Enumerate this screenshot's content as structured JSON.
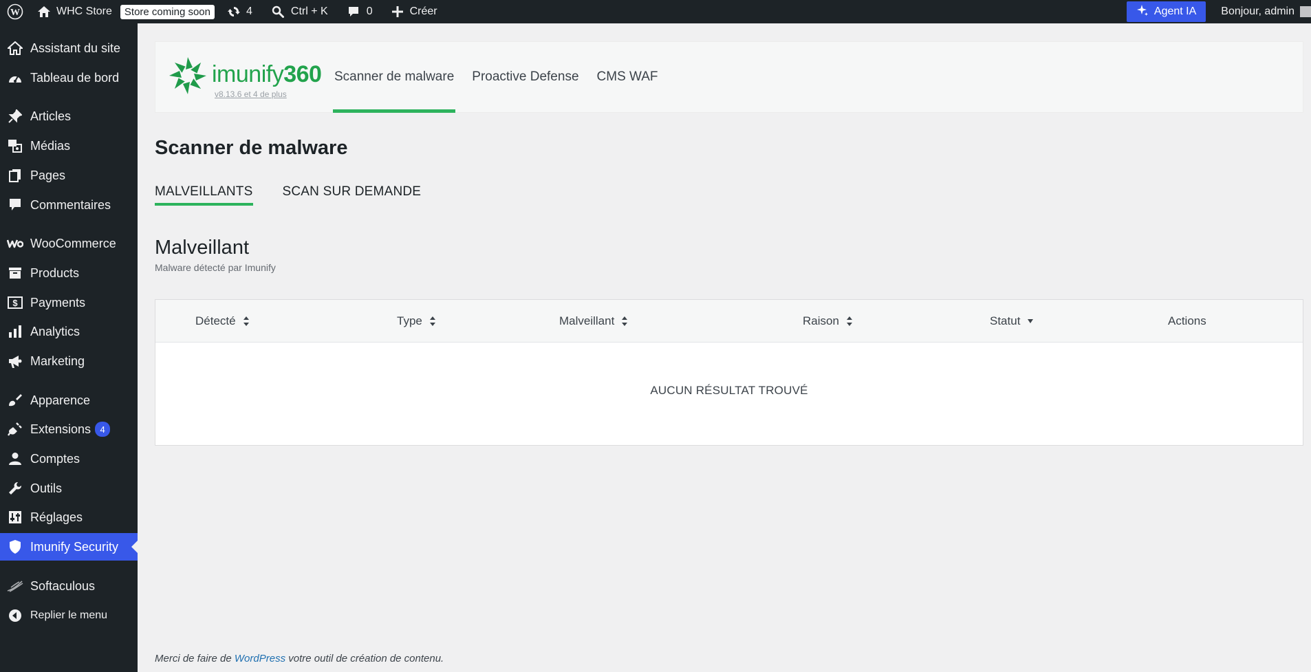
{
  "adminbar": {
    "site_name": "WHC Store",
    "store_badge": "Store coming soon",
    "updates_count": "4",
    "search_shortcut": "Ctrl + K",
    "comments_count": "0",
    "create_label": "Créer",
    "agent_label": "Agent IA",
    "greeting": "Bonjour, admin"
  },
  "sidebar": {
    "items": [
      {
        "label": "Assistant du site",
        "icon": "home-icon"
      },
      {
        "label": "Tableau de bord",
        "icon": "dashboard-icon"
      },
      {
        "label": "Articles",
        "icon": "pin-icon"
      },
      {
        "label": "Médias",
        "icon": "media-icon"
      },
      {
        "label": "Pages",
        "icon": "pages-icon"
      },
      {
        "label": "Commentaires",
        "icon": "comment-icon"
      },
      {
        "label": "WooCommerce",
        "icon": "woo-icon"
      },
      {
        "label": "Products",
        "icon": "archive-icon"
      },
      {
        "label": "Payments",
        "icon": "dollar-icon"
      },
      {
        "label": "Analytics",
        "icon": "bar-chart-icon"
      },
      {
        "label": "Marketing",
        "icon": "megaphone-icon"
      },
      {
        "label": "Apparence",
        "icon": "brush-icon"
      },
      {
        "label": "Extensions",
        "icon": "plugin-icon",
        "badge": "4"
      },
      {
        "label": "Comptes",
        "icon": "user-icon"
      },
      {
        "label": "Outils",
        "icon": "wrench-icon"
      },
      {
        "label": "Réglages",
        "icon": "sliders-icon"
      },
      {
        "label": "Imunify Security",
        "icon": "shield-icon"
      },
      {
        "label": "Softaculous",
        "icon": "softaculous-icon"
      },
      {
        "label": "Replier le menu",
        "icon": "collapse-icon"
      }
    ]
  },
  "plugin": {
    "logo_text": "imunify",
    "logo_num": "360",
    "version": "v8.13.6 et 4 de plus",
    "tabs": [
      "Scanner de malware",
      "Proactive Defense",
      "CMS WAF"
    ]
  },
  "page": {
    "title": "Scanner de malware",
    "sub_tabs": [
      "MALVEILLANTS",
      "SCAN SUR DEMANDE"
    ],
    "section_title": "Malveillant",
    "section_subtitle": "Malware détecté par Imunify"
  },
  "table": {
    "columns": [
      "Détecté",
      "Type",
      "Malveillant",
      "Raison",
      "Statut",
      "Actions"
    ],
    "empty_text": "AUCUN RÉSULTAT TROUVÉ"
  },
  "footer": {
    "before": "Merci de faire de ",
    "link": "WordPress",
    "after": " votre outil de création de contenu."
  },
  "colors": {
    "accent": "#3858e9",
    "imunify_green": "#2db35d",
    "adminbar_bg": "#1d2327"
  }
}
